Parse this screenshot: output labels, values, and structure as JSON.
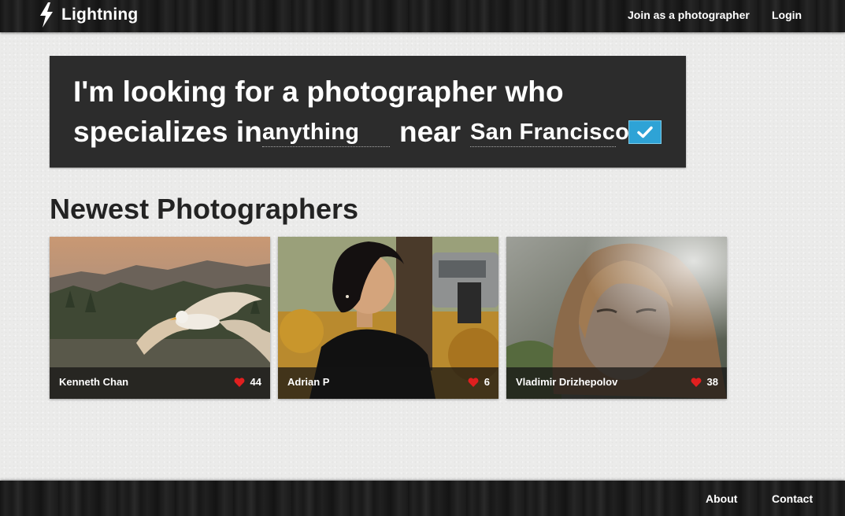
{
  "header": {
    "brand": "Lightning",
    "nav": {
      "join": "Join as a photographer",
      "login": "Login"
    }
  },
  "search": {
    "line1": "I'm looking for a photographer who",
    "line2_prefix": "specializes in",
    "specialty_value": "anything",
    "near_word": "near",
    "location_value": "San Francisco",
    "submit_icon": "checkmark-icon",
    "colors": {
      "panel": "#2c2c2c",
      "button": "#2ea3d6"
    }
  },
  "section": {
    "title": "Newest Photographers"
  },
  "photographers": [
    {
      "name": "Kenneth Chan",
      "likes": "44",
      "photo": "seagull-in-flight"
    },
    {
      "name": "Adrian P",
      "likes": "6",
      "photo": "woman-portrait-outdoors"
    },
    {
      "name": "Vladimir Drizhepolov",
      "likes": "38",
      "photo": "woman-portrait-backlit"
    }
  ],
  "footer": {
    "about": "About",
    "contact": "Contact"
  },
  "icons": {
    "like": "heart-icon",
    "brand": "lightning-bolt-icon"
  }
}
